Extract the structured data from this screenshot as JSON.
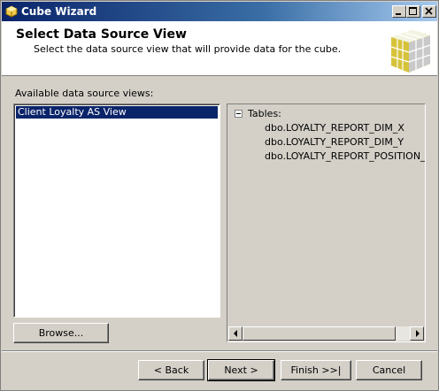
{
  "window": {
    "title": "Cube Wizard",
    "icon": "cube-app-icon",
    "controls": [
      "minimize-icon",
      "maximize-icon",
      "close-icon"
    ]
  },
  "header": {
    "title": "Select Data Source View",
    "subtitle": "Select the data source view that will provide data for the cube."
  },
  "data_source_views": {
    "label": "Available data source views:",
    "items": [
      "Client Loyalty AS View"
    ],
    "selected": "Client Loyalty AS View"
  },
  "tables_tree": {
    "root_label": "Tables:",
    "children": [
      "dbo.LOYALTY_REPORT_DIM_X",
      "dbo.LOYALTY_REPORT_DIM_Y",
      "dbo.LOYALTY_REPORT_POSITION_DA"
    ]
  },
  "buttons": {
    "browse": "Browse...",
    "back": "< Back",
    "next": "Next >",
    "finish": "Finish >>|",
    "cancel": "Cancel"
  },
  "colors": {
    "titlebar_start": "#0a246a",
    "selection": "#0a246a",
    "face": "#d4d0c8"
  }
}
